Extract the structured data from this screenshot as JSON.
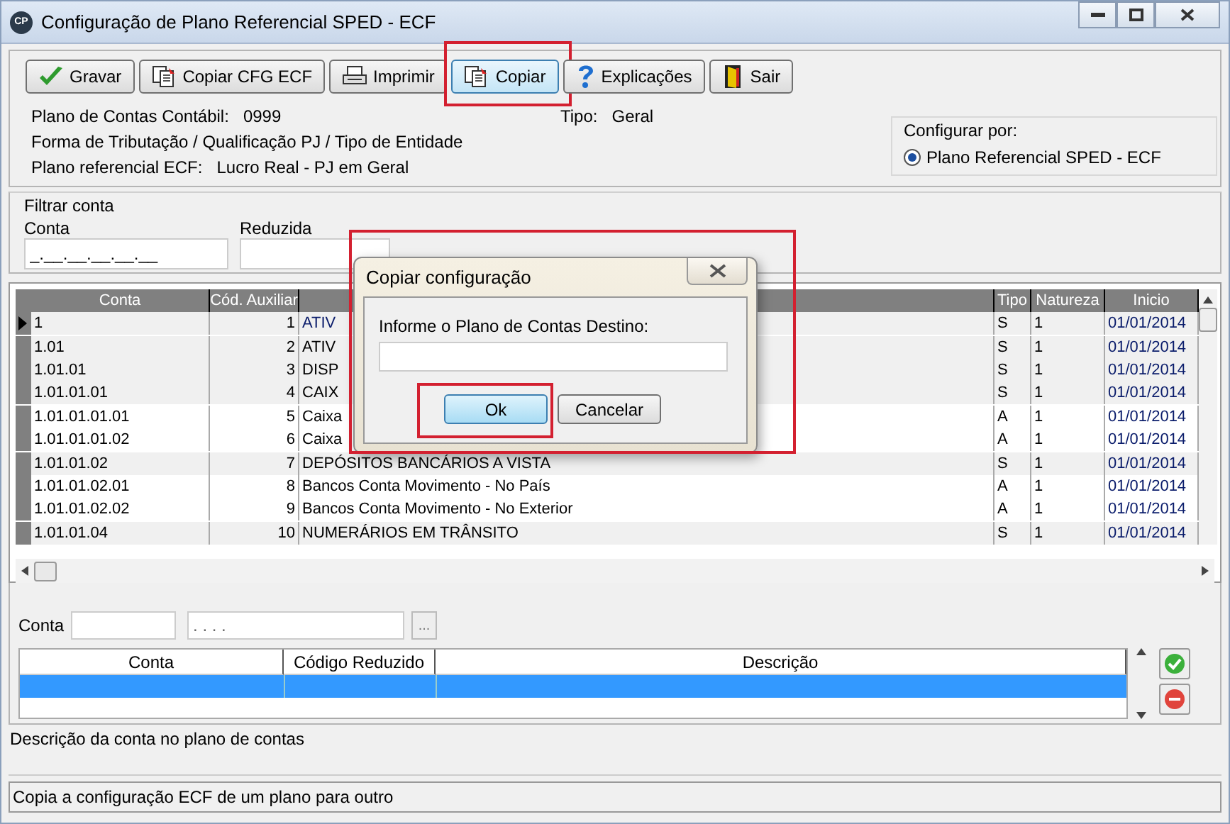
{
  "window": {
    "icon_text": "CP",
    "title": "Configuração de Plano Referencial SPED - ECF"
  },
  "toolbar": [
    {
      "label": "Gravar",
      "kind": "save",
      "highlighted": false
    },
    {
      "label": "Copiar CFG ECF",
      "kind": "copy",
      "highlighted": false
    },
    {
      "label": "Imprimir",
      "kind": "print",
      "highlighted": false
    },
    {
      "label": "Copiar",
      "kind": "copy",
      "highlighted": true
    },
    {
      "label": "Explicações",
      "kind": "help",
      "highlighted": false
    },
    {
      "label": "Sair",
      "kind": "exit",
      "highlighted": false
    }
  ],
  "info": {
    "plano_label": "Plano de Contas Contábil:",
    "plano_value": "0999",
    "tipo_label": "Tipo:",
    "tipo_value": "Geral",
    "forma_label": "Forma de Tributação / Qualificação PJ / Tipo de Entidade",
    "referencial_label": "Plano referencial ECF:",
    "referencial_value": "Lucro Real - PJ em Geral"
  },
  "configurar_por": {
    "title": "Configurar por:",
    "options": [
      {
        "label": "Plano Referencial SPED - ECF",
        "selected": true
      }
    ]
  },
  "filter": {
    "title": "Filtrar conta",
    "conta_label": "Conta",
    "conta_value": "_.__.__.__.__.__",
    "reduzida_label": "Reduzida"
  },
  "grid": {
    "columns": [
      "Conta",
      "Cód. Auxiliar",
      "Tipo",
      "Natureza",
      "Inicio"
    ],
    "rows": [
      {
        "conta": "1",
        "aux": "1",
        "descricao": "ATIV",
        "tipo": "S",
        "natureza": "1",
        "inicio": "01/01/2014",
        "kind": "synthetic",
        "selected": true
      },
      {
        "conta": "1.01",
        "aux": "2",
        "descricao": "ATIV",
        "tipo": "S",
        "natureza": "1",
        "inicio": "01/01/2014",
        "kind": "synthetic",
        "selected": false
      },
      {
        "conta": "1.01.01",
        "aux": "3",
        "descricao": "DISP",
        "tipo": "S",
        "natureza": "1",
        "inicio": "01/01/2014",
        "kind": "synthetic",
        "selected": false
      },
      {
        "conta": "1.01.01.01",
        "aux": "4",
        "descricao": "CAIX",
        "tipo": "S",
        "natureza": "1",
        "inicio": "01/01/2014",
        "kind": "synthetic",
        "selected": false
      },
      {
        "conta": "1.01.01.01.01",
        "aux": "5",
        "descricao": "Caixa",
        "tipo": "A",
        "natureza": "1",
        "inicio": "01/01/2014",
        "kind": "analytic",
        "selected": false
      },
      {
        "conta": "1.01.01.01.02",
        "aux": "6",
        "descricao": "Caixa",
        "tipo": "A",
        "natureza": "1",
        "inicio": "01/01/2014",
        "kind": "analytic",
        "selected": false
      },
      {
        "conta": "1.01.01.02",
        "aux": "7",
        "descricao": "DEPÓSITOS BANCÁRIOS A VISTA",
        "tipo": "S",
        "natureza": "1",
        "inicio": "01/01/2014",
        "kind": "synthetic",
        "selected": false
      },
      {
        "conta": "1.01.01.02.01",
        "aux": "8",
        "descricao": "Bancos Conta Movimento - No País",
        "tipo": "A",
        "natureza": "1",
        "inicio": "01/01/2014",
        "kind": "analytic",
        "selected": false
      },
      {
        "conta": "1.01.01.02.02",
        "aux": "9",
        "descricao": "Bancos Conta Movimento - No Exterior",
        "tipo": "A",
        "natureza": "1",
        "inicio": "01/01/2014",
        "kind": "analytic",
        "selected": false
      },
      {
        "conta": "1.01.01.04",
        "aux": "10",
        "descricao": "NUMERÁRIOS EM TRÂNSITO",
        "tipo": "S",
        "natureza": "1",
        "inicio": "01/01/2014",
        "kind": "synthetic",
        "selected": false
      }
    ]
  },
  "selection": {
    "conta_label": "Conta",
    "mask_value": ". . . .",
    "browse_button": "...",
    "columns": [
      "Conta",
      "Código Reduzido",
      "Descrição"
    ]
  },
  "description": "Descrição da conta no plano de contas",
  "status_bar": "Copia a configuração ECF de um plano para outro",
  "dialog": {
    "title": "Copiar configuração",
    "prompt": "Informe o Plano de Contas Destino:",
    "buttons": [
      {
        "label": "Ok",
        "highlighted": true
      },
      {
        "label": "Cancelar",
        "highlighted": false
      }
    ],
    "highlighted": true
  }
}
